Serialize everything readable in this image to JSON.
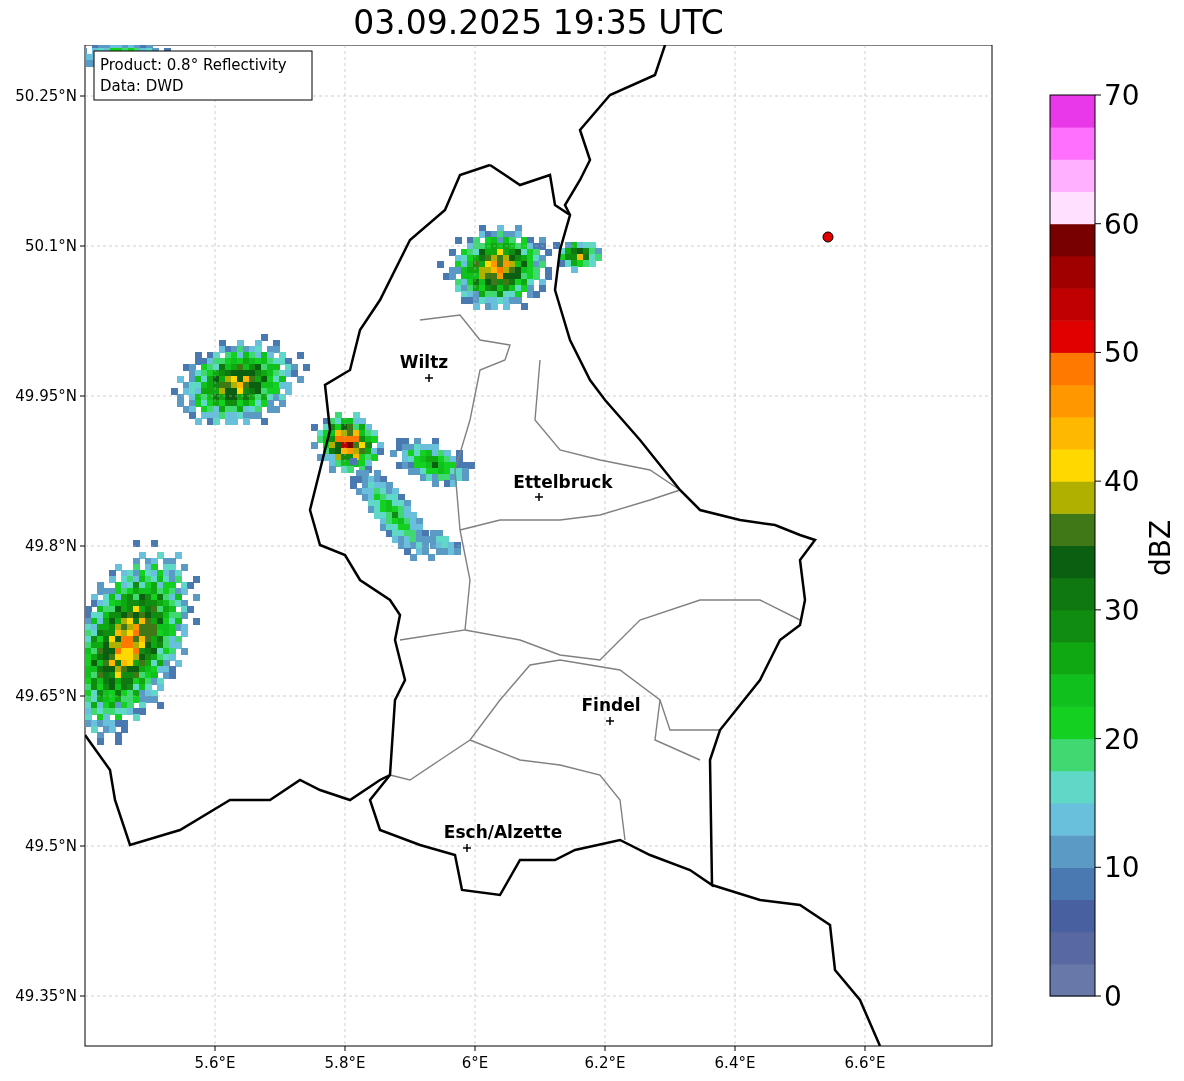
{
  "title": "03.09.2025 19:35 UTC",
  "annotation": [
    "Product: 0.8° Reflectivity",
    "Data: DWD"
  ],
  "x_ticks": [
    "5.6°E",
    "5.8°E",
    "6°E",
    "6.2°E",
    "6.4°E",
    "6.6°E"
  ],
  "y_ticks": [
    "50.25°N",
    "50.1°N",
    "49.95°N",
    "49.8°N",
    "49.65°N",
    "49.5°N",
    "49.35°N"
  ],
  "cities": [
    {
      "name": "Wiltz"
    },
    {
      "name": "Ettelbruck"
    },
    {
      "name": "Findel"
    },
    {
      "name": "Esch/Alzette"
    }
  ],
  "colorbar": {
    "label": "dBZ",
    "ticks": [
      "70",
      "60",
      "50",
      "40",
      "30",
      "20",
      "10",
      "0"
    ],
    "bands": [
      {
        "color": "#6878a8"
      },
      {
        "color": "#5868a0"
      },
      {
        "color": "#4860a0"
      },
      {
        "color": "#4a78b0"
      },
      {
        "color": "#5a9ac4"
      },
      {
        "color": "#68c0dc"
      },
      {
        "color": "#60d8c8"
      },
      {
        "color": "#40d870"
      },
      {
        "color": "#14d020"
      },
      {
        "color": "#10c01c"
      },
      {
        "color": "#10a810"
      },
      {
        "color": "#108c10"
      },
      {
        "color": "#107810"
      },
      {
        "color": "#0a6010"
      },
      {
        "color": "#407818"
      },
      {
        "color": "#b0b000"
      },
      {
        "color": "#ffd800"
      },
      {
        "color": "#ffb800"
      },
      {
        "color": "#ff9800"
      },
      {
        "color": "#ff7800"
      },
      {
        "color": "#e00000"
      },
      {
        "color": "#c00000"
      },
      {
        "color": "#a00000"
      },
      {
        "color": "#780000"
      },
      {
        "color": "#ffe0ff"
      },
      {
        "color": "#ffb0ff"
      },
      {
        "color": "#ff70ff"
      },
      {
        "color": "#e838e8"
      }
    ]
  }
}
